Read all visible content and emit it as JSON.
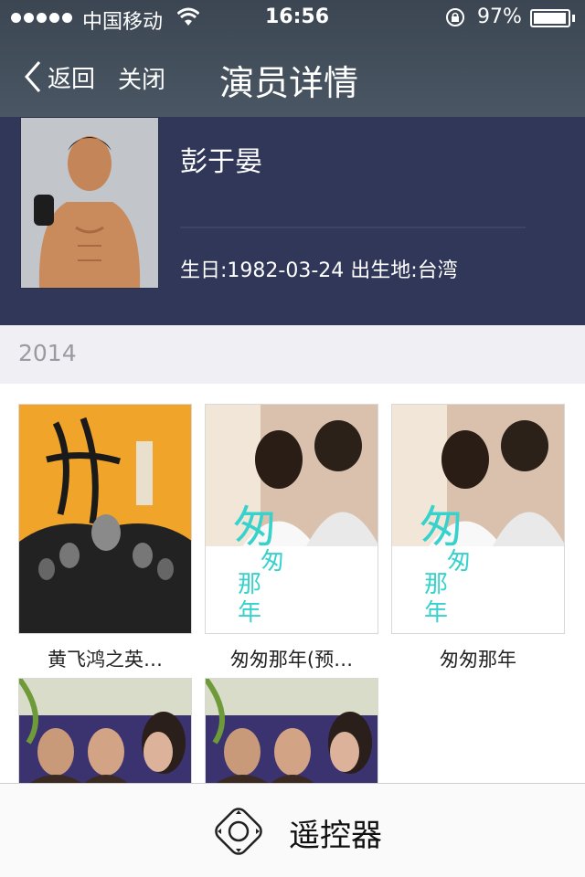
{
  "status_bar": {
    "carrier": "中国移动",
    "time": "16:56",
    "battery": "97%",
    "battery_level": 0.97,
    "signal_icon": "signal-dots-icon",
    "wifi_icon": "wifi-icon",
    "lock_icon": "rotation-lock-icon"
  },
  "nav": {
    "back_label": "返回",
    "close_label": "关闭",
    "title": "演员详情"
  },
  "actor": {
    "name": "彭于晏",
    "info": "生日:1982-03-24  出生地:台湾"
  },
  "section": {
    "year": "2014"
  },
  "movies": [
    {
      "title": "黄飞鸿之英…",
      "poster": "kungfu-orange"
    },
    {
      "title": "匆匆那年(预…",
      "poster": "couple-white"
    },
    {
      "title": "匆匆那年",
      "poster": "couple-white"
    },
    {
      "title": "",
      "poster": "costume-drama"
    },
    {
      "title": "",
      "poster": "costume-drama"
    }
  ],
  "bottom": {
    "label": "遥控器",
    "icon": "remote-control-icon"
  },
  "colors": {
    "nav_bg": "#414c58",
    "actor_bg": "#313759",
    "section_bg": "#efeff4",
    "poster_accent": "#38d2cc"
  }
}
